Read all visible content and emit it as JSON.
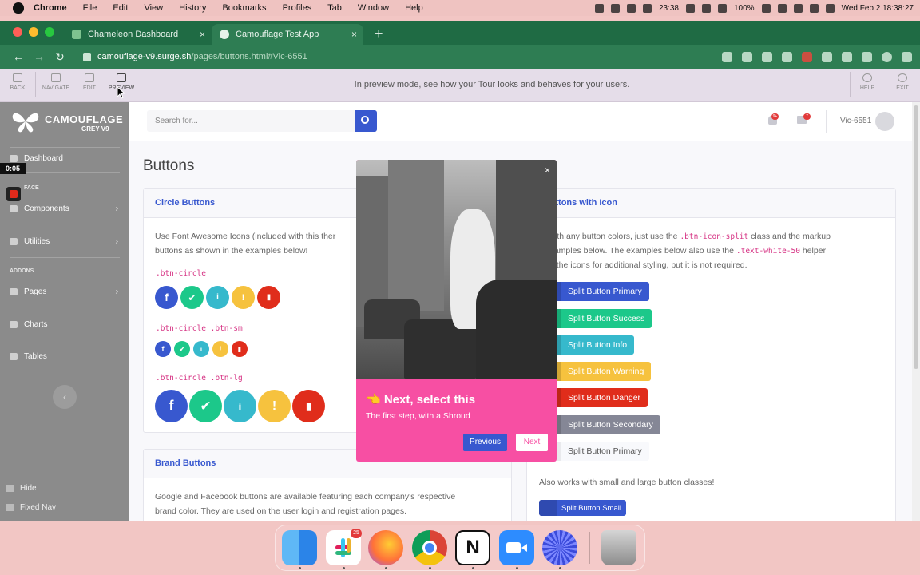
{
  "mac_menubar": {
    "app": "Chrome",
    "items": [
      "File",
      "Edit",
      "View",
      "History",
      "Bookmarks",
      "Profiles",
      "Tab",
      "Window",
      "Help"
    ],
    "time": "23:38",
    "battery": "100%",
    "datetime": "Wed Feb 2  18:38:27"
  },
  "browser": {
    "tabs": [
      {
        "label": "Chameleon Dashboard",
        "close": "×"
      },
      {
        "label": "Camouflage Test App",
        "close": "×"
      }
    ],
    "new_tab": "+",
    "url_host": "camouflage-v9.surge.sh",
    "url_path": "/pages/buttons.html#Vic-6551"
  },
  "tour_toolbar": {
    "back": "BACK",
    "navigate": "NAVIGATE",
    "edit": "EDIT",
    "preview": "PREVIEW",
    "message": "In preview mode, see how your Tour looks and behaves for your users.",
    "help": "HELP",
    "exit": "EXIT"
  },
  "sidebar": {
    "brand_title": "CAMOUFLAGE",
    "brand_sub": "GREY V9",
    "dashboard": "Dashboard",
    "interface_heading": "FACE",
    "components": "Components",
    "utilities": "Utilities",
    "addons_heading": "ADDONS",
    "pages": "Pages",
    "charts": "Charts",
    "tables": "Tables",
    "toggle": "‹",
    "hide": "Hide",
    "fixed_nav": "Fixed Nav",
    "chevron": "›"
  },
  "recording": {
    "timer": "0:05"
  },
  "topbar": {
    "search_placeholder": "Search for...",
    "alerts_badge": "9+",
    "messages_badge": "7",
    "username": "Vic-6551"
  },
  "page": {
    "title": "Buttons",
    "circle_card": {
      "header": "Circle Buttons",
      "desc_line1": "Use Font Awesome Icons (included with this ther",
      "desc_line2": "buttons as shown in the examples below!",
      "code1": ".btn-circle",
      "code2": ".btn-circle .btn-sm",
      "code3": ".btn-circle .btn-lg",
      "glyphs": [
        "f",
        "✔",
        "i",
        "!",
        "▮"
      ]
    },
    "brand_card": {
      "header": "Brand Buttons",
      "desc_line1": "Google and Facebook buttons are available featuring each company's respective",
      "desc_line2": "brand color. They are used on the user login and registration pages."
    },
    "split_card": {
      "header": "t Buttons with Icon",
      "desc_a": "ks with any button colors, just use the",
      "code_a": ".btn-icon-split",
      "desc_b": "class and the markup",
      "desc_c": "e examples below. The examples below also use the",
      "code_b": ".text-white-50",
      "desc_d": "helper",
      "desc_e": "s on the icons for additional styling, but it is not required.",
      "buttons": [
        {
          "label": "Split Button Primary",
          "color": "#3858cf"
        },
        {
          "label": "Split Button Success",
          "color": "#1cc88a"
        },
        {
          "label": "Split Button Info",
          "color": "#36b9cc"
        },
        {
          "label": "Split Button Warning",
          "color": "#f6c23e"
        },
        {
          "label": "Split Button Danger",
          "color": "#e02d1b"
        },
        {
          "label": "Split Button Secondary",
          "color": "#858796"
        },
        {
          "label": "Split Button Primary",
          "color": "#f8f9fc"
        }
      ],
      "also_text": "Also works with small and large button classes!",
      "small_button": "Split Button Small"
    }
  },
  "tour_popup": {
    "title": "👈 Next, select this",
    "subtitle": "The first step, with a Shroud",
    "close": "×",
    "previous": "Previous",
    "next": "Next"
  },
  "dock": {
    "apps": [
      "Finder",
      "Slack",
      "Firefox",
      "Chrome",
      "Notion",
      "Zoom",
      "Chameleon",
      "Trash"
    ],
    "slack_badge": "25"
  },
  "colors": {
    "primary": "#3858cf",
    "success": "#1cc88a",
    "info": "#36b9cc",
    "warning": "#f6c23e",
    "danger": "#e02d1b",
    "popup": "#f74fa3",
    "browser_chrome": "#1f6b44"
  }
}
